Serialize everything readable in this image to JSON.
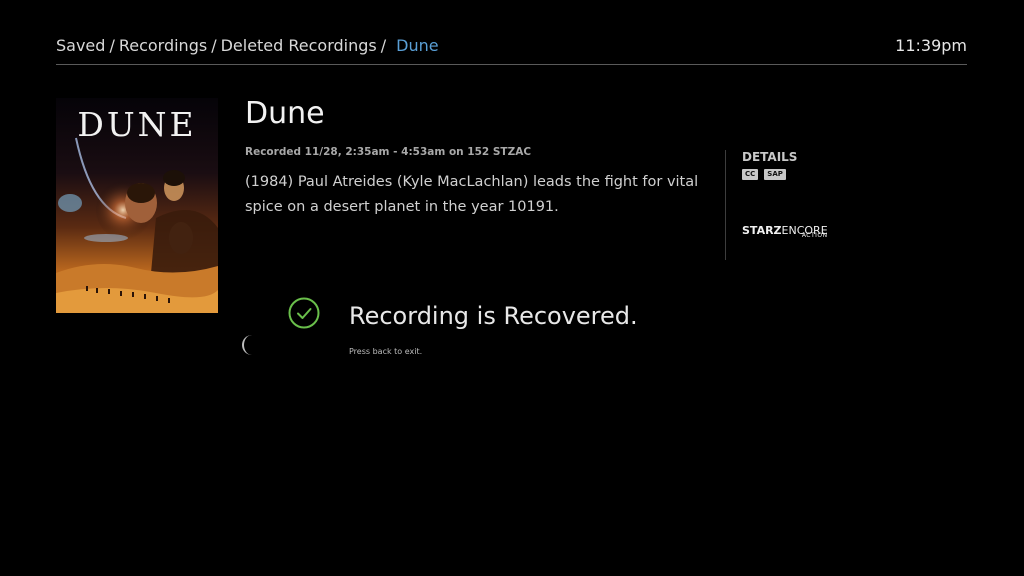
{
  "header": {
    "breadcrumb": [
      "Saved",
      "Recordings",
      "Deleted Recordings"
    ],
    "current": "Dune",
    "separator": "/",
    "clock": "11:39pm"
  },
  "poster": {
    "title_text": "DUNE"
  },
  "program": {
    "title": "Dune",
    "recorded_info": "Recorded 11/28, 2:35am - 4:53am on 152 STZAC",
    "description": "(1984) Paul Atreides (Kyle MacLachlan) leads the fight for vital spice on a desert planet in the year 10191."
  },
  "details": {
    "heading": "DETAILS",
    "badges": [
      "CC",
      "SAP"
    ],
    "network": {
      "bold": "STARZ",
      "light": "ENCORE",
      "sub": "ACTION"
    }
  },
  "confirmation": {
    "message": "Recording is Recovered.",
    "hint": "Press back to exit."
  },
  "colors": {
    "background": "#000000",
    "accent_blue": "#5a9fd6",
    "success_green": "#6abf4b"
  }
}
